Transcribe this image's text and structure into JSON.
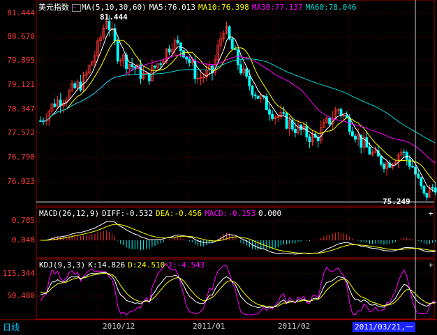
{
  "main": {
    "title": "美元指数",
    "ma_label": "MA(5,10,30,60)",
    "ma5": "MA5:76.013",
    "ma10": "MA10:76.398",
    "ma30": "MA30:77.137",
    "ma60": "MA60:78.046",
    "high_label": "81.444",
    "low_label": "75.249",
    "y_ticks": [
      "81.444",
      "80.670",
      "79.895",
      "79.121",
      "78.347",
      "77.572",
      "76.798",
      "76.023"
    ]
  },
  "macd": {
    "label": "MACD(26,12,9)",
    "diff": "DIFF:-0.532",
    "dea": "DEA:-0.456",
    "macd": "MACD:-0.153",
    "extra": "0.000",
    "y_ticks": [
      "0.785",
      "0.048"
    ]
  },
  "kdj": {
    "label": "KDJ(9,3,3)",
    "k": "K:14.826",
    "d": "D:24.510",
    "j": "J:-4.543",
    "y_ticks": [
      "115.344",
      "50.480"
    ]
  },
  "axis": {
    "x_labels": [
      "2010/12",
      "2011/01",
      "2011/02"
    ],
    "period": "日线",
    "cursor_date": "2011/03/21,一"
  },
  "colors": {
    "up": "#ff3232",
    "down": "#00ffff",
    "ma5": "#ffffff",
    "ma10": "#ffff00",
    "ma30": "#ff00ff",
    "ma60": "#00d8d8",
    "axis": "#a00000"
  }
}
